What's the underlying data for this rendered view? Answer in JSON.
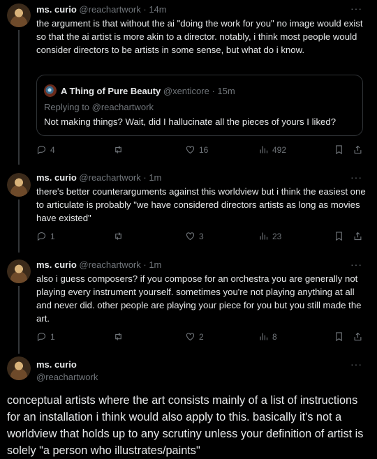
{
  "tweets": [
    {
      "name": "ms. curio",
      "handle": "@reachartwork",
      "time": "· 14m",
      "text": "the argument is that without the ai \"doing the work for you\" no image would exist so that the ai artist is more akin to a director. notably, i think most people would consider directors to be artists in some sense, but what do i know.",
      "replies": "4",
      "likes": "16",
      "views": "492"
    },
    {
      "name": "ms. curio",
      "handle": "@reachartwork",
      "time": "· 1m",
      "text": "there's better counterarguments against this worldview but i think the easiest one to articulate is probably \"we have considered directors artists as long as movies have existed\"",
      "replies": "1",
      "likes": "3",
      "views": "23"
    },
    {
      "name": "ms. curio",
      "handle": "@reachartwork",
      "time": "· 1m",
      "text": "also i guess composers? if you compose for an orchestra you are generally not playing every instrument yourself. sometimes you're not playing anything at all and never did. other people are playing your piece for you but you still made the art.",
      "replies": "1",
      "likes": "2",
      "views": "8"
    },
    {
      "name": "ms. curio",
      "handle": "@reachartwork",
      "text": "conceptual artists where the art consists mainly of a list of instructions for an installation i think would also apply to this. basically it's not a worldview that holds up to any scrutiny unless your definition of artist is solely \"a person who illustrates/paints\""
    }
  ],
  "quote": {
    "name": "A Thing of Pure Beauty",
    "handle": "@xenticore",
    "time": "· 15m",
    "replying": "Replying to @reachartwork",
    "text": "Not making things? Wait, did I hallucinate all the pieces of yours I liked?"
  },
  "more_glyph": "···",
  "icons": [
    "reply-icon",
    "retweet-icon",
    "like-icon",
    "views-icon",
    "bookmark-icon",
    "share-icon"
  ]
}
